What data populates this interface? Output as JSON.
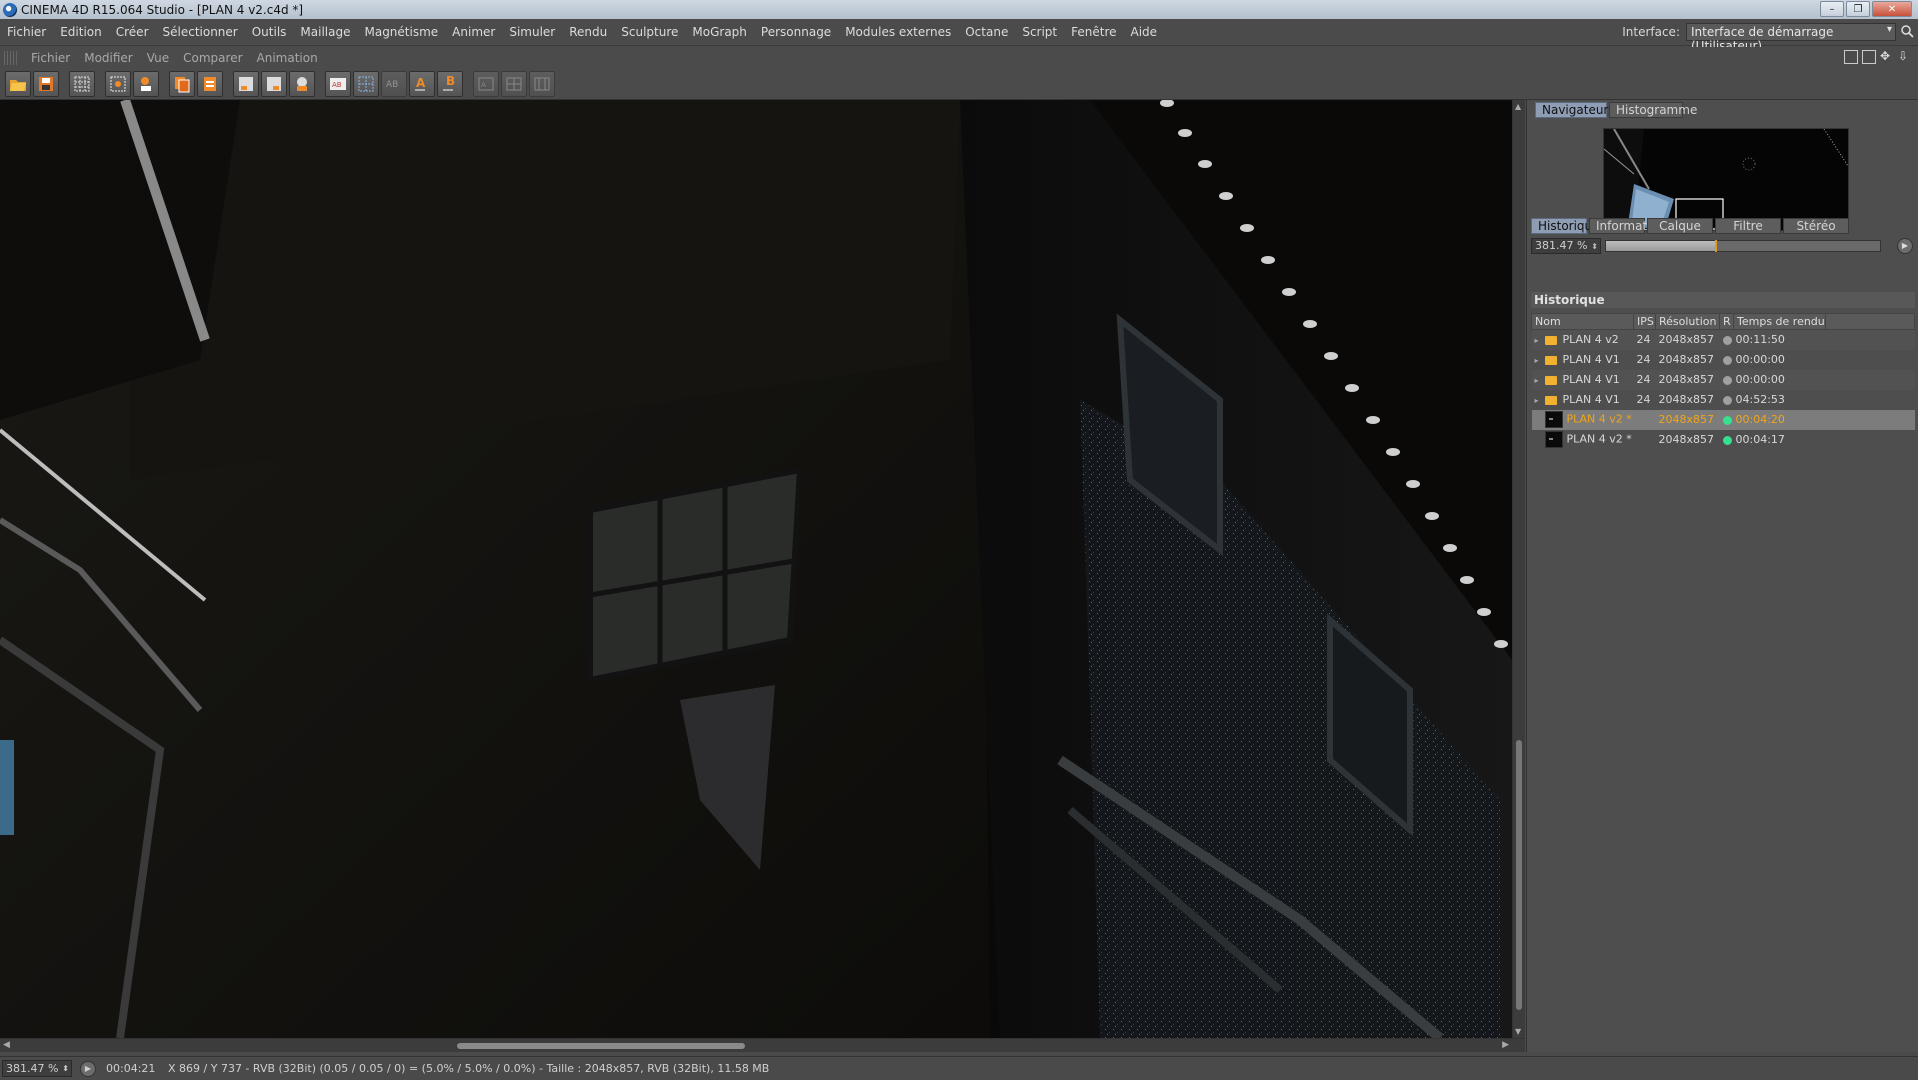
{
  "window": {
    "title": "CINEMA 4D R15.064 Studio - [PLAN 4 v2.c4d *]",
    "minimize": "–",
    "maximize": "❐",
    "close": "✕"
  },
  "menu": {
    "items": [
      "Fichier",
      "Edition",
      "Créer",
      "Sélectionner",
      "Outils",
      "Maillage",
      "Magnétisme",
      "Animer",
      "Simuler",
      "Rendu",
      "Sculpture",
      "MoGraph",
      "Personnage",
      "Modules externes",
      "Octane",
      "Script",
      "Fenêtre",
      "Aide"
    ],
    "interface_label": "Interface:",
    "interface_value": "Interface de démarrage (Utilisateur)"
  },
  "submenu": {
    "items": [
      "Fichier",
      "Modifier",
      "Vue",
      "Comparer",
      "Animation"
    ]
  },
  "toolbar": {
    "icons": [
      "open-icon",
      "save-icon",
      "grid-icon",
      "render-settings-icon",
      "channel-icon",
      "copy-icon",
      "paste-icon",
      "region-a-icon",
      "region-b-icon",
      "region-compare-icon",
      "split-ab-icon",
      "split-grid-icon",
      "label-ab-icon",
      "set-a-icon",
      "set-b-icon",
      "swap-a-icon",
      "swap-b-icon",
      "swap-c-icon"
    ]
  },
  "panel": {
    "top_tabs": [
      {
        "label": "Navigateur",
        "active": true
      },
      {
        "label": "Histogramme",
        "active": false
      }
    ],
    "zoom": "381.47 %",
    "zoom_fraction": 0.4,
    "bottom_tabs": [
      {
        "label": "Historique",
        "active": true
      },
      {
        "label": "Information",
        "active": false
      },
      {
        "label": "Calque",
        "active": false
      },
      {
        "label": "Filtre",
        "active": false
      },
      {
        "label": "Stéréo",
        "active": false
      }
    ],
    "history": {
      "title": "Historique",
      "columns": [
        "Nom",
        "IPS",
        "Résolution",
        "R",
        "Temps de rendu"
      ],
      "rows": [
        {
          "name": "PLAN 4 v2",
          "fps": "24",
          "res": "2048x857",
          "time": "00:11:50",
          "type": "folder",
          "status": "done"
        },
        {
          "name": "PLAN 4 V1",
          "fps": "24",
          "res": "2048x857",
          "time": "00:00:00",
          "type": "folder",
          "status": "done"
        },
        {
          "name": "PLAN 4 V1",
          "fps": "24",
          "res": "2048x857",
          "time": "00:00:00",
          "type": "folder",
          "status": "done"
        },
        {
          "name": "PLAN 4 V1",
          "fps": "24",
          "res": "2048x857",
          "time": "04:52:53",
          "type": "folder",
          "status": "done"
        },
        {
          "name": "PLAN 4 v2 *",
          "fps": "",
          "res": "2048x857",
          "time": "00:04:20",
          "type": "image",
          "status": "ok",
          "selected": true
        },
        {
          "name": "PLAN 4 v2 *",
          "fps": "",
          "res": "2048x857",
          "time": "00:04:17",
          "type": "image",
          "status": "ok"
        }
      ]
    }
  },
  "status": {
    "zoom": "381.47 %",
    "time": "00:04:21",
    "info": "X 869 / Y 737 - RVB (32Bit) (0.05 / 0.05 / 0) = (5.0% / 5.0% / 0.0%) - Taille : 2048x857, RVB (32Bit), 11.58 MB"
  }
}
